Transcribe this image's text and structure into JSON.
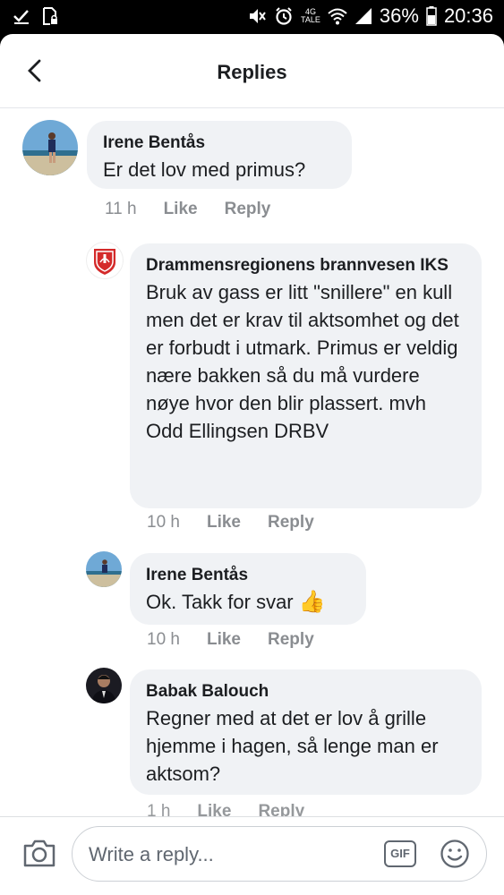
{
  "status_bar": {
    "network_top": "4G",
    "network_bottom": "TALE",
    "battery": "36%",
    "time": "20:36"
  },
  "header": {
    "title": "Replies",
    "back_icon": "chevron-left-icon"
  },
  "comments": [
    {
      "author": "Irene Bentås",
      "text": "Er det lov med primus?",
      "time": "11 h",
      "like": "Like",
      "reply": "Reply"
    },
    {
      "author": "Drammensregionens brannvesen IKS",
      "text": "Bruk av gass er litt \"snillere\" en kull men det er krav til aktsomhet og det er forbudt i utmark. Primus er veldig nære bakken så du må vurdere nøye hvor den blir plassert. mvh Odd Ellingsen DRBV",
      "time": "10 h",
      "like": "Like",
      "reply": "Reply"
    },
    {
      "author": "Irene Bentås",
      "text": "Ok. Takk for svar",
      "emoji": "👍",
      "time": "10 h",
      "like": "Like",
      "reply": "Reply"
    },
    {
      "author": "Babak Balouch",
      "text": "Regner med at det er lov å grille hjemme i hagen, så lenge man er aktsom?",
      "time": "1 h",
      "like": "Like",
      "reply": "Reply"
    }
  ],
  "composer": {
    "placeholder": "Write a reply...",
    "gif_label": "GIF",
    "camera_icon": "camera-icon",
    "emoji_icon": "smiley-icon"
  },
  "colors": {
    "bubble": "#f0f2f5",
    "meta_text": "#8a8d91",
    "brand_red": "#d42a2a"
  }
}
